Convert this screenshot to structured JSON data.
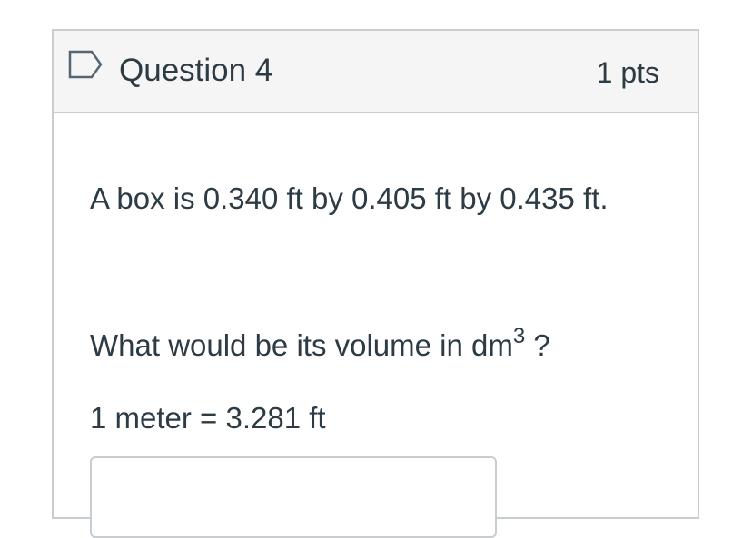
{
  "question": {
    "flag_icon": "flag-outline-icon",
    "title": "Question 4",
    "points": "1 pts",
    "paragraph1": "A box is 0.340 ft by 0.405 ft by 0.435 ft.",
    "paragraph2_prefix": "What would be its volume in dm",
    "paragraph2_sup": "3",
    "paragraph2_suffix": " ?",
    "paragraph3": "1 meter = 3.281 ft",
    "answer_value": ""
  },
  "colors": {
    "text": "#2d3b45",
    "header_bg": "#f5f5f5",
    "border": "#c7cdd1",
    "flag": "#556572"
  }
}
